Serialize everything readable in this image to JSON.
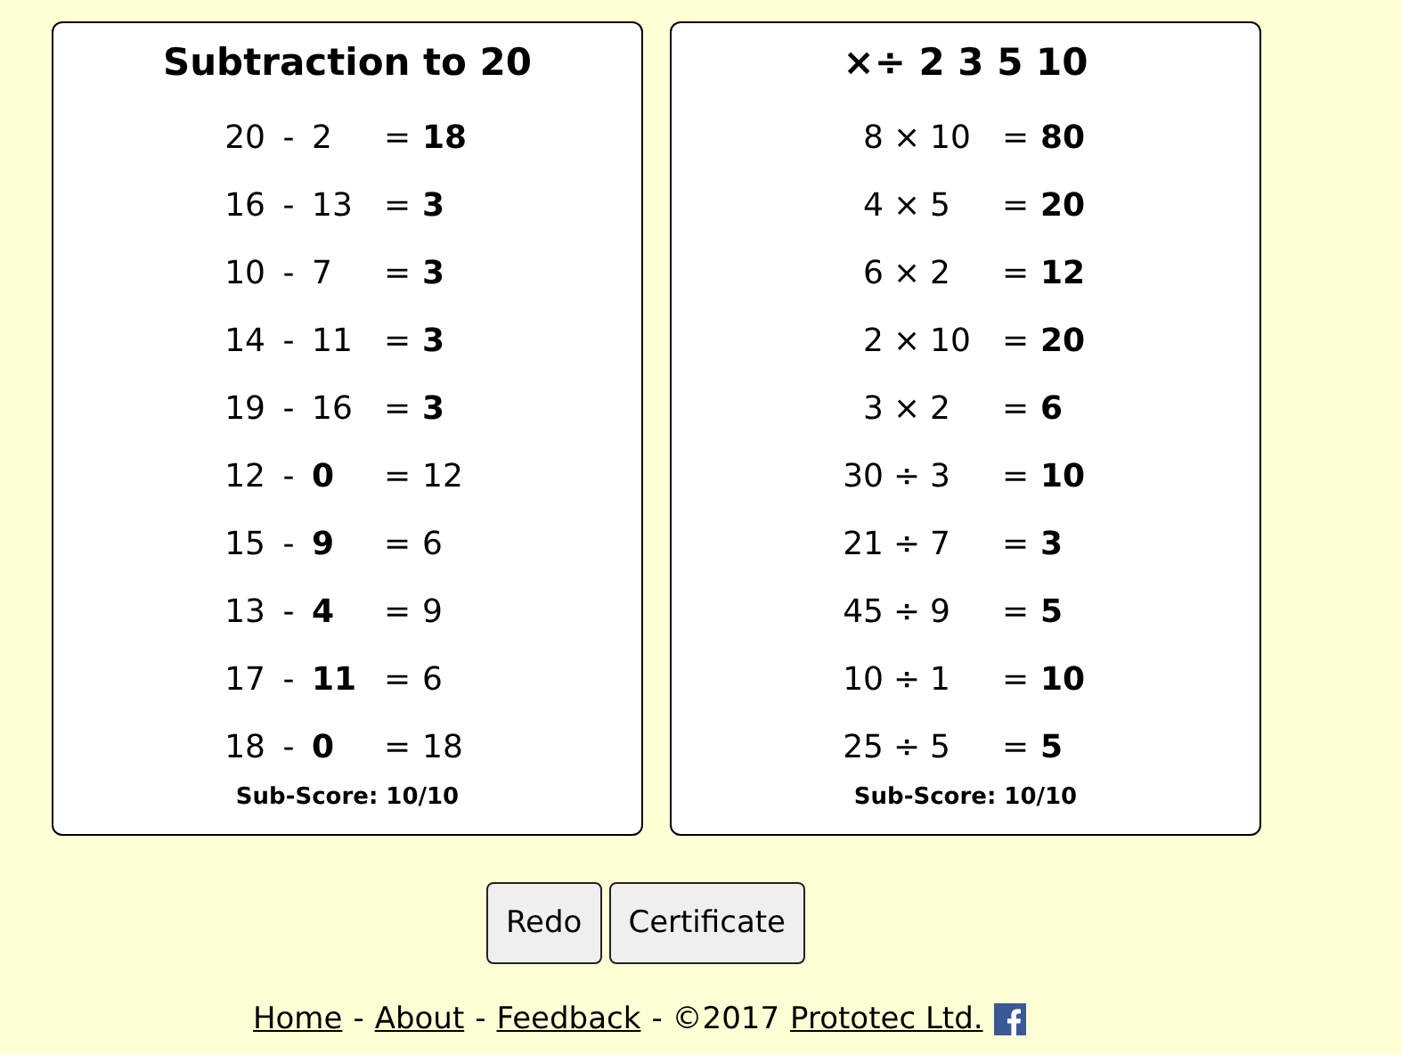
{
  "panels": [
    {
      "title": "Subtraction to 20",
      "sub_score": "Sub-Score: 10/10",
      "rows": [
        {
          "a": "20",
          "op": "-",
          "b": "2",
          "eq": "=",
          "result": "18",
          "b_filled": false,
          "result_filled": true
        },
        {
          "a": "16",
          "op": "-",
          "b": "13",
          "eq": "=",
          "result": "3",
          "b_filled": false,
          "result_filled": true
        },
        {
          "a": "10",
          "op": "-",
          "b": "7",
          "eq": "=",
          "result": "3",
          "b_filled": false,
          "result_filled": true
        },
        {
          "a": "14",
          "op": "-",
          "b": "11",
          "eq": "=",
          "result": "3",
          "b_filled": false,
          "result_filled": true
        },
        {
          "a": "19",
          "op": "-",
          "b": "16",
          "eq": "=",
          "result": "3",
          "b_filled": false,
          "result_filled": true
        },
        {
          "a": "12",
          "op": "-",
          "b": "0",
          "eq": "=",
          "result": "12",
          "b_filled": true,
          "result_filled": false
        },
        {
          "a": "15",
          "op": "-",
          "b": "9",
          "eq": "=",
          "result": "6",
          "b_filled": true,
          "result_filled": false
        },
        {
          "a": "13",
          "op": "-",
          "b": "4",
          "eq": "=",
          "result": "9",
          "b_filled": true,
          "result_filled": false
        },
        {
          "a": "17",
          "op": "-",
          "b": "11",
          "eq": "=",
          "result": "6",
          "b_filled": true,
          "result_filled": false
        },
        {
          "a": "18",
          "op": "-",
          "b": "0",
          "eq": "=",
          "result": "18",
          "b_filled": true,
          "result_filled": false
        }
      ]
    },
    {
      "title": "×÷ 2 3 5 10",
      "sub_score": "Sub-Score: 10/10",
      "rows": [
        {
          "a": "8",
          "op": "×",
          "b": "10",
          "eq": "=",
          "result": "80",
          "b_filled": false,
          "result_filled": true
        },
        {
          "a": "4",
          "op": "×",
          "b": "5",
          "eq": "=",
          "result": "20",
          "b_filled": false,
          "result_filled": true
        },
        {
          "a": "6",
          "op": "×",
          "b": "2",
          "eq": "=",
          "result": "12",
          "b_filled": false,
          "result_filled": true
        },
        {
          "a": "2",
          "op": "×",
          "b": "10",
          "eq": "=",
          "result": "20",
          "b_filled": false,
          "result_filled": true
        },
        {
          "a": "3",
          "op": "×",
          "b": "2",
          "eq": "=",
          "result": "6",
          "b_filled": false,
          "result_filled": true
        },
        {
          "a": "30",
          "op": "÷",
          "b": "3",
          "eq": "=",
          "result": "10",
          "b_filled": false,
          "result_filled": true
        },
        {
          "a": "21",
          "op": "÷",
          "b": "7",
          "eq": "=",
          "result": "3",
          "b_filled": false,
          "result_filled": true
        },
        {
          "a": "45",
          "op": "÷",
          "b": "9",
          "eq": "=",
          "result": "5",
          "b_filled": false,
          "result_filled": true
        },
        {
          "a": "10",
          "op": "÷",
          "b": "1",
          "eq": "=",
          "result": "10",
          "b_filled": false,
          "result_filled": true
        },
        {
          "a": "25",
          "op": "÷",
          "b": "5",
          "eq": "=",
          "result": "5",
          "b_filled": false,
          "result_filled": true
        }
      ]
    }
  ],
  "buttons": [
    "Redo",
    "Certificate"
  ],
  "footer": [
    {
      "kind": "link",
      "text": "Home"
    },
    {
      "kind": "text",
      "text": "-"
    },
    {
      "kind": "link",
      "text": "About"
    },
    {
      "kind": "text",
      "text": "-"
    },
    {
      "kind": "link",
      "text": "Feedback"
    },
    {
      "kind": "text",
      "text": "- ©2017"
    },
    {
      "kind": "link",
      "text": "Prototec Ltd."
    },
    {
      "kind": "facebook"
    }
  ]
}
